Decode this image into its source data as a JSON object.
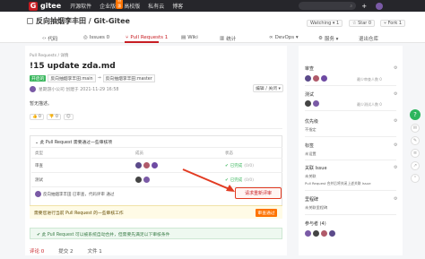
{
  "topnav": {
    "logo_letter": "G",
    "logo_text": "gitee",
    "links": [
      "开源软件",
      "企业版",
      "高校版",
      "私有云",
      "博客"
    ],
    "badge": "特惠",
    "search_icon": "search-icon",
    "plus": "+"
  },
  "repo": {
    "name": "反向抽烟李丰田 / Git-Gitee",
    "watching": "Watching ▾ 1",
    "star": "☆ Star 0",
    "fork": "⑂ Fork 1"
  },
  "tabs": [
    {
      "label": "代码",
      "icon": "code-icon"
    },
    {
      "label": "Issues 0",
      "icon": "issue-icon"
    },
    {
      "label": "Pull Requests 1",
      "icon": "pr-icon",
      "active": true
    },
    {
      "label": "Wiki",
      "icon": "wiki-icon"
    },
    {
      "label": "统计",
      "icon": "stats-icon"
    },
    {
      "label": "DevOps ▾",
      "icon": "devops-icon"
    },
    {
      "label": "服务 ▾",
      "icon": "service-icon"
    },
    {
      "label": "退出仓库",
      "icon": "exit-icon"
    }
  ],
  "pr": {
    "breadcrumb": "Pull Requests / 详情",
    "title": "!15  update zda.md",
    "status": "开启的",
    "source": "反向抽烟李丰田:main",
    "merge_text": "→",
    "target": "反向抽烟李丰田:master",
    "author_line": "星期游小公司  创建于 2021-11-29 16:58",
    "edit_label": "编辑 / 关闭 ▾",
    "description": "暂无描述。",
    "reactions": [
      "👍 0",
      "👎 0",
      "☺"
    ]
  },
  "review": {
    "header": "此 Pull Request 需要通过一些审核项",
    "columns": [
      "类型",
      "成员",
      "状态"
    ],
    "rows": [
      {
        "type": "审查",
        "status": "已完成",
        "count": "(0/0)"
      },
      {
        "type": "测试",
        "status": "已完成",
        "count": "(0/0)"
      }
    ],
    "approve_line": "反向抽烟李丰田 已审查，代码评审 通过",
    "rerequest_label": "请求重新评审",
    "warning": "需要您进行当前 Pull Request 的一些审核工作",
    "approve_btn": "审查通过"
  },
  "ok_bar": "此 Pull Request 可以被系统自动合并，但需要先满足以下审核条件",
  "bottom_tabs": [
    "评论 0",
    "提交 2",
    "文件 1"
  ],
  "sidebar": {
    "reviewers_label": "审查",
    "reviewers_sub": "最少审查人数 0",
    "testers_label": "测试",
    "testers_sub": "最少测试人数 0",
    "priority_label": "优先级",
    "priority_value": "不指定",
    "labels_label": "标签",
    "labels_value": "未设置",
    "issues_label": "关联 Issue",
    "issues_value": "未关联",
    "issues_note": "Pull Request 合并后将关闭上述关联 Issue",
    "milestone_label": "里程碑",
    "milestone_value": "未关联里程碑",
    "participants_label": "参与者 (4)"
  },
  "colors": {
    "brand": "#c71d23",
    "accent_orange": "#fe7300",
    "success": "#3bb75e"
  }
}
